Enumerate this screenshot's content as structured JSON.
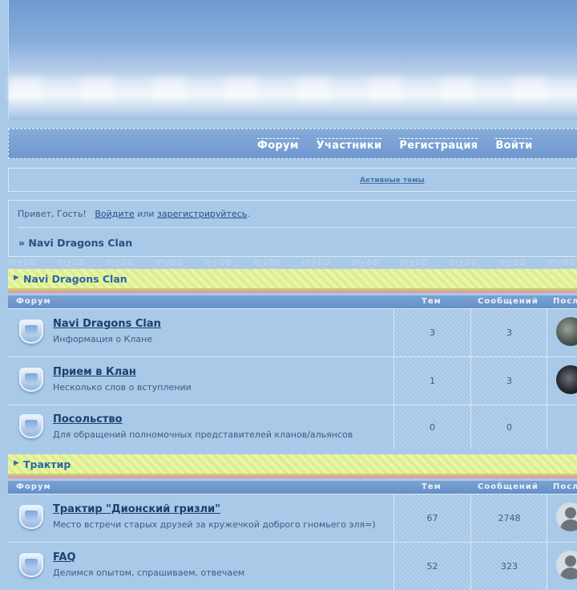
{
  "nav": {
    "items": [
      "Форум",
      "Участники",
      "Регистрация",
      "Войти"
    ]
  },
  "topbar": {
    "active_topics": "Активные темы"
  },
  "greeting": {
    "prefix": "Привет, Гость!",
    "login_link": "Войдите",
    "or": "или",
    "register_link": "зарегистрируйтесь",
    "suffix": "."
  },
  "breadcrumb": "» Navi Dragons Clan",
  "watermark": "mybb",
  "columns": {
    "forum": "Форум",
    "topics": "Тем",
    "posts": "Сообщений",
    "last": "Посл"
  },
  "categories": [
    {
      "title": "Navi Dragons Clan",
      "forums": [
        {
          "name": "Navi Dragons Clan",
          "desc": "Информация о Клане",
          "topics": "3",
          "posts": "3",
          "avatar": "dragon-avatar"
        },
        {
          "name": "Прием в Клан",
          "desc": "Несколько слов о вступлении",
          "topics": "1",
          "posts": "3",
          "avatar": "helmet-avatar"
        },
        {
          "name": "Посольство",
          "desc": "Для обращений полномочных представителей кланов/альянсов",
          "topics": "0",
          "posts": "0",
          "avatar": ""
        }
      ]
    },
    {
      "title": "Трактир",
      "forums": [
        {
          "name": "Трактир \"Дионский гризли\"",
          "desc": "Место встречи старых друзей за кружечкой доброго гномьего эля=)",
          "topics": "67",
          "posts": "2748",
          "avatar": "user-avatar"
        },
        {
          "name": "FAQ",
          "desc": "Делимся опытом, спрашиваем, отвечаем",
          "topics": "52",
          "posts": "323",
          "avatar": "user-avatar"
        }
      ]
    }
  ]
}
